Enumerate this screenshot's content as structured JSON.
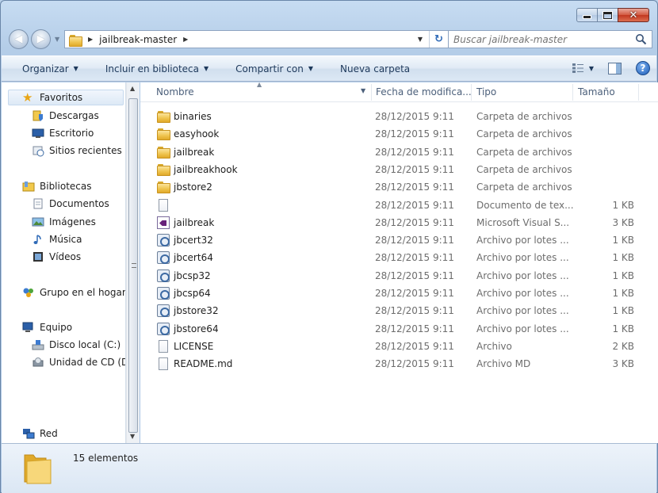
{
  "window": {
    "caption_buttons": {
      "minimize_icon": "minimize-icon",
      "maximize_icon": "maximize-icon",
      "close_icon": "close-icon"
    }
  },
  "address": {
    "crumb": "jailbreak-master",
    "search_placeholder": "Buscar jailbreak-master"
  },
  "toolbar": {
    "organize": "Organizar",
    "include_library": "Incluir en biblioteca",
    "share": "Compartir con",
    "new_folder": "Nueva carpeta"
  },
  "nav": {
    "favorites": "Favoritos",
    "downloads": "Descargas",
    "desktop": "Escritorio",
    "recent": "Sitios recientes",
    "libraries": "Bibliotecas",
    "documents": "Documentos",
    "images": "Imágenes",
    "music": "Música",
    "videos": "Vídeos",
    "homegroup": "Grupo en el hogar",
    "computer": "Equipo",
    "local_disk": "Disco local (C:)",
    "cd_drive": "Unidad de CD (D:",
    "network": "Red"
  },
  "columns": {
    "name": "Nombre",
    "date": "Fecha de modifica...",
    "type": "Tipo",
    "size": "Tamaño"
  },
  "files": [
    {
      "name": "binaries",
      "date": "28/12/2015 9:11",
      "type": "Carpeta de archivos",
      "size": "",
      "icon": "folder-icon"
    },
    {
      "name": "easyhook",
      "date": "28/12/2015 9:11",
      "type": "Carpeta de archivos",
      "size": "",
      "icon": "folder-icon"
    },
    {
      "name": "jailbreak",
      "date": "28/12/2015 9:11",
      "type": "Carpeta de archivos",
      "size": "",
      "icon": "folder-icon"
    },
    {
      "name": "jailbreakhook",
      "date": "28/12/2015 9:11",
      "type": "Carpeta de archivos",
      "size": "",
      "icon": "folder-icon"
    },
    {
      "name": "jbstore2",
      "date": "28/12/2015 9:11",
      "type": "Carpeta de archivos",
      "size": "",
      "icon": "folder-icon"
    },
    {
      "name": "",
      "date": "28/12/2015 9:11",
      "type": "Documento de tex...",
      "size": "1 KB",
      "icon": "text-file-icon"
    },
    {
      "name": "jailbreak",
      "date": "28/12/2015 9:11",
      "type": "Microsoft Visual S...",
      "size": "3 KB",
      "icon": "visual-studio-icon"
    },
    {
      "name": "jbcert32",
      "date": "28/12/2015 9:11",
      "type": "Archivo por lotes ...",
      "size": "1 KB",
      "icon": "batch-file-icon"
    },
    {
      "name": "jbcert64",
      "date": "28/12/2015 9:11",
      "type": "Archivo por lotes ...",
      "size": "1 KB",
      "icon": "batch-file-icon"
    },
    {
      "name": "jbcsp32",
      "date": "28/12/2015 9:11",
      "type": "Archivo por lotes ...",
      "size": "1 KB",
      "icon": "batch-file-icon"
    },
    {
      "name": "jbcsp64",
      "date": "28/12/2015 9:11",
      "type": "Archivo por lotes ...",
      "size": "1 KB",
      "icon": "batch-file-icon"
    },
    {
      "name": "jbstore32",
      "date": "28/12/2015 9:11",
      "type": "Archivo por lotes ...",
      "size": "1 KB",
      "icon": "batch-file-icon"
    },
    {
      "name": "jbstore64",
      "date": "28/12/2015 9:11",
      "type": "Archivo por lotes ...",
      "size": "1 KB",
      "icon": "batch-file-icon"
    },
    {
      "name": "LICENSE",
      "date": "28/12/2015 9:11",
      "type": "Archivo",
      "size": "2 KB",
      "icon": "file-icon"
    },
    {
      "name": "README.md",
      "date": "28/12/2015 9:11",
      "type": "Archivo MD",
      "size": "3 KB",
      "icon": "file-icon"
    }
  ],
  "status": {
    "count": "15 elementos"
  }
}
